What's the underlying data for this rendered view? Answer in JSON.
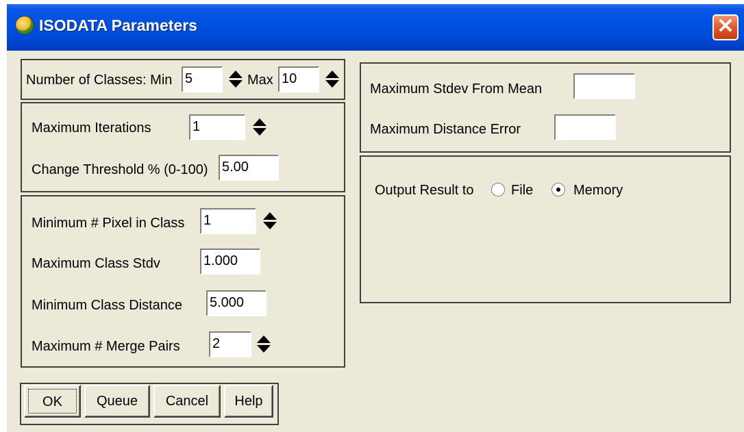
{
  "window": {
    "title": "ISODATA Parameters",
    "close_glyph": "✕",
    "icon": "app-globe-icon"
  },
  "classes": {
    "label": "Number of Classes: Min",
    "min": "5",
    "max_label": "Max",
    "max": "10"
  },
  "iterations": {
    "label": "Maximum Iterations",
    "value": "1"
  },
  "threshold": {
    "label": "Change Threshold % (0-100)",
    "value": "5.00"
  },
  "min_pixel": {
    "label": "Minimum # Pixel in Class",
    "value": "1"
  },
  "max_stdv": {
    "label": "Maximum Class Stdv",
    "value": "1.000"
  },
  "min_dist": {
    "label": "Minimum Class Distance",
    "value": "5.000"
  },
  "merge_pairs": {
    "label": "Maximum # Merge Pairs",
    "value": "2"
  },
  "stdev_mean": {
    "label": "Maximum Stdev From Mean",
    "value": ""
  },
  "dist_error": {
    "label": "Maximum Distance Error",
    "value": ""
  },
  "output": {
    "label": "Output Result to",
    "file_label": "File",
    "memory_label": "Memory",
    "selected": "Memory"
  },
  "buttons": {
    "ok": "OK",
    "queue": "Queue",
    "cancel": "Cancel",
    "help": "Help"
  },
  "colors": {
    "title_bar": "#0050e0",
    "dialog_bg": "#ece9d8",
    "close_button": "#e1572c"
  }
}
